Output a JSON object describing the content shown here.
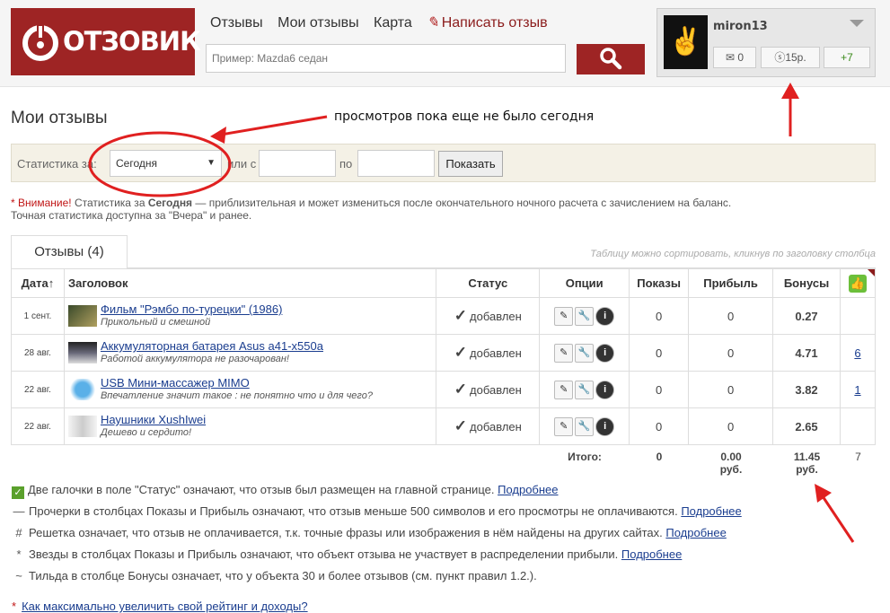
{
  "brand": {
    "logo_text": "ОТЗОВИК"
  },
  "nav": {
    "items": [
      "Отзывы",
      "Мои отзывы",
      "Карта"
    ],
    "write_label": "Написать отзыв"
  },
  "search": {
    "placeholder": "Пример: Mazda6 седан"
  },
  "user": {
    "name": "miron13",
    "messages": "0",
    "balance": "15р.",
    "rating": "+7"
  },
  "page": {
    "title": "Мои отзывы"
  },
  "filter": {
    "label_for": "Статистика за:",
    "selected": "Сегодня",
    "label_or_from": "или с",
    "label_to": "по",
    "button": "Показать"
  },
  "notice": {
    "warn": "* Внимание!",
    "pre": "Статистика за",
    "bold": "Сегодня",
    "post": "— приблизительная и может измениться после окончательного ночного расчета с зачислением на баланс.",
    "line2": "Точная статистика доступна за \"Вчера\" и ранее."
  },
  "tab": {
    "label": "Отзывы (4)"
  },
  "table_hint": "Таблицу можно сортировать, кликнув по заголовку столбца",
  "table": {
    "headers": {
      "date": "Дата↑",
      "title": "Заголовок",
      "status": "Статус",
      "options": "Опции",
      "views": "Показы",
      "profit": "Прибыль",
      "bonus": "Бонусы"
    },
    "rows": [
      {
        "date": "1 сент.",
        "title": "Фильм \"Рэмбо по-турецки\" (1986)",
        "subtitle": "Прикольный и смешной",
        "status": "добавлен",
        "views": "0",
        "profit": "0",
        "bonus": "0.27",
        "likes": ""
      },
      {
        "date": "28 авг.",
        "title": "Аккумуляторная батарея Asus a41-x550a",
        "subtitle": "Работой аккумулятора не разочарован!",
        "status": "добавлен",
        "views": "0",
        "profit": "0",
        "bonus": "4.71",
        "likes": "6"
      },
      {
        "date": "22 авг.",
        "title": "USB Мини-массажер MIMO",
        "subtitle": "Впечатление значит такое : не понятно что и для чего?",
        "status": "добавлен",
        "views": "0",
        "profit": "0",
        "bonus": "3.82",
        "likes": "1"
      },
      {
        "date": "22 авг.",
        "title": "Наушники XushIwei",
        "subtitle": "Дешево и сердито!",
        "status": "добавлен",
        "views": "0",
        "profit": "0",
        "bonus": "2.65",
        "likes": ""
      }
    ],
    "totals": {
      "label": "Итого:",
      "views": "0",
      "profit": "0.00",
      "profit_unit": "руб.",
      "bonus": "11.45",
      "bonus_unit": "руб.",
      "likes": "7"
    }
  },
  "legend": [
    {
      "symbol": "✓",
      "text": "Две галочки в поле \"Статус\" означают, что отзыв был размещен на главной странице.",
      "link": "Подробнее"
    },
    {
      "symbol": "—",
      "text": "Прочерки в столбцах Показы и Прибыль означают, что отзыв меньше 500 символов и его просмотры не оплачиваются.",
      "link": "Подробнее"
    },
    {
      "symbol": "#",
      "text": "Решетка означает, что отзыв не оплачивается, т.к. точные фразы или изображения в нём найдены на других сайтах.",
      "link": "Подробнее"
    },
    {
      "symbol": "*",
      "text": "Звезды в столбцах Показы и Прибыль означают, что объект отзыва не участвует в распределении прибыли.",
      "link": "Подробнее"
    },
    {
      "symbol": "~",
      "text": "Тильда в столбце Бонусы означает, что у объекта 30 и более отзывов (см. пункт правил 1.2.).",
      "link": ""
    }
  ],
  "footer_link": "Как максимально увеличить свой рейтинг и доходы?",
  "annotation": {
    "text": "просмотров пока еще не было  сегодня",
    "color": "#e02020"
  }
}
